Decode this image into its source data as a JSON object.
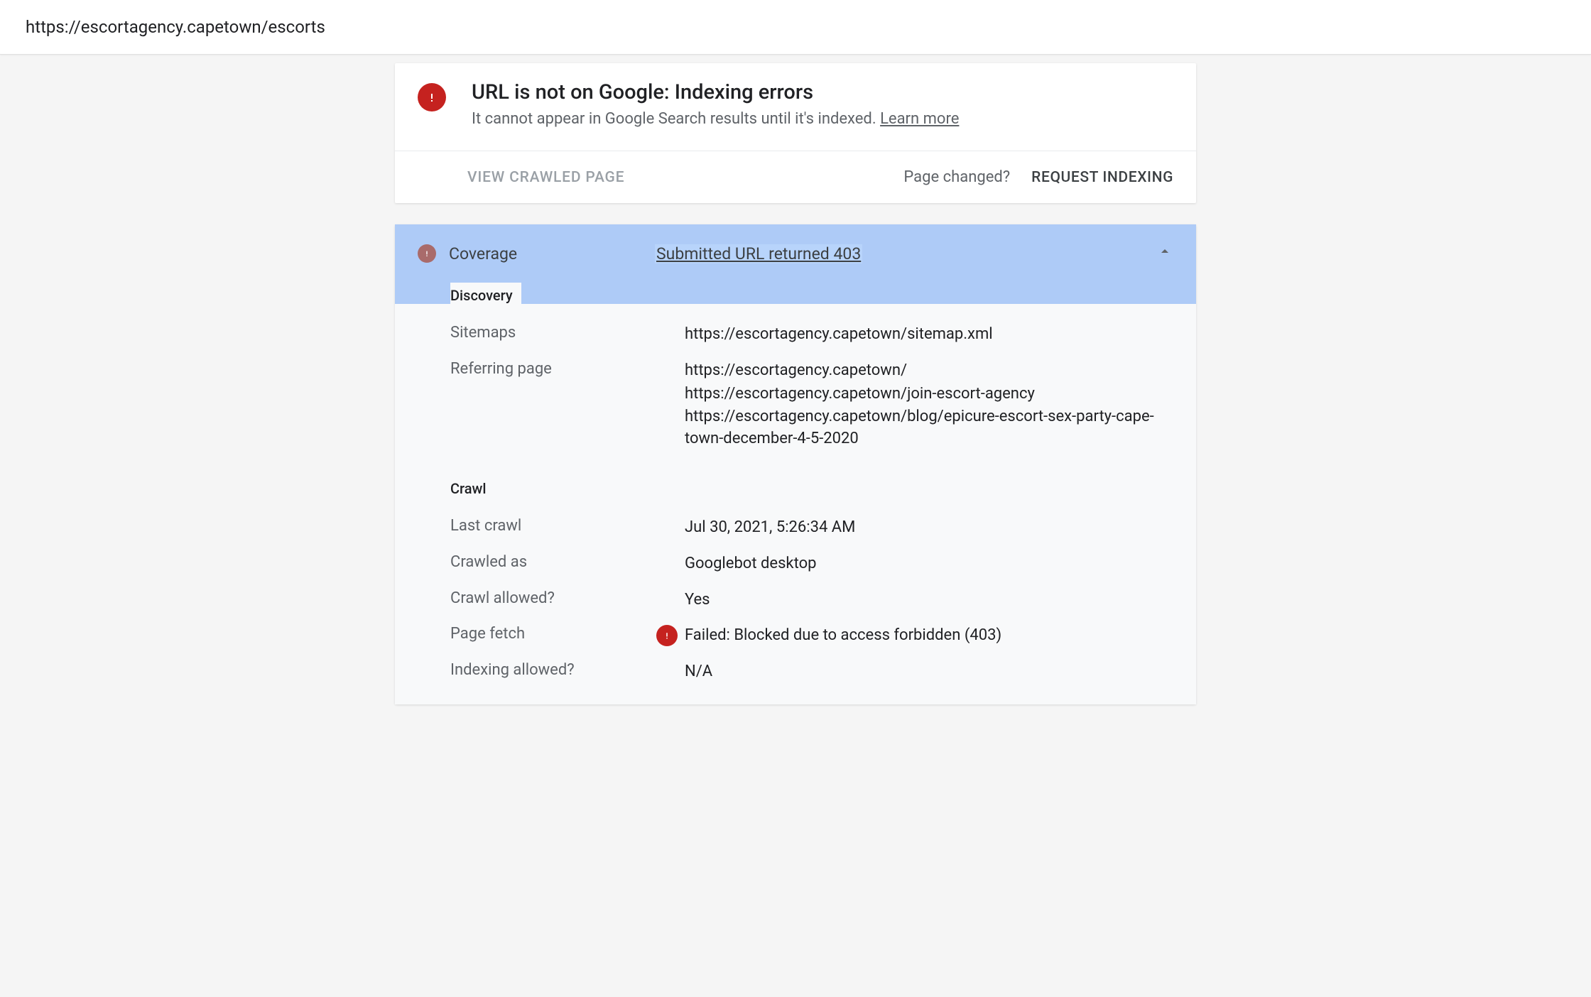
{
  "url_bar": "https://escortagency.capetown/escorts",
  "status": {
    "title": "URL is not on Google: Indexing errors",
    "subtitle_prefix": "It cannot appear in Google Search results until it's indexed. ",
    "learn_more": "Learn more"
  },
  "actions": {
    "view_crawled": "VIEW CRAWLED PAGE",
    "page_changed": "Page changed?",
    "request_indexing": "REQUEST INDEXING"
  },
  "coverage": {
    "label": "Coverage",
    "value": "Submitted URL returned 403"
  },
  "discovery": {
    "title": "Discovery",
    "sitemaps_label": "Sitemaps",
    "sitemaps_value": "https://escortagency.capetown/sitemap.xml",
    "referring_label": "Referring page",
    "referring_values": [
      "https://escortagency.capetown/",
      "https://escortagency.capetown/join-escort-agency",
      "https://escortagency.capetown/blog/epicure-escort-sex-party-cape-town-december-4-5-2020"
    ]
  },
  "crawl": {
    "title": "Crawl",
    "last_crawl_label": "Last crawl",
    "last_crawl_value": "Jul 30, 2021, 5:26:34 AM",
    "crawled_as_label": "Crawled as",
    "crawled_as_value": "Googlebot desktop",
    "crawl_allowed_label": "Crawl allowed?",
    "crawl_allowed_value": "Yes",
    "page_fetch_label": "Page fetch",
    "page_fetch_value": "Failed: Blocked due to access forbidden (403)",
    "indexing_allowed_label": "Indexing allowed?",
    "indexing_allowed_value": "N/A"
  }
}
